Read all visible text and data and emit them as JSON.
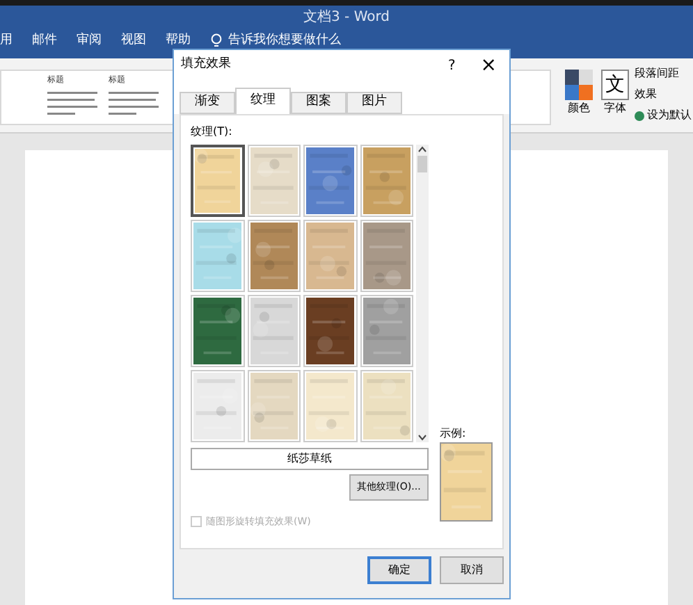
{
  "word": {
    "title": "文档3 - Word",
    "menu": [
      "用",
      "邮件",
      "审阅",
      "视图",
      "帮助"
    ],
    "tell_me": "告诉我你想要做什么",
    "styles": [
      "标题",
      "标题"
    ],
    "colors_label": "颜色",
    "fonts_label": "字体",
    "fonts_glyph": "文",
    "paragraph_spacing": "段落间距",
    "effects": "效果",
    "set_default": "设为默认"
  },
  "dialog": {
    "title": "填充效果",
    "help": "?",
    "close": "×",
    "tabs": [
      {
        "label": "渐变",
        "selected": false
      },
      {
        "label": "纹理",
        "selected": true
      },
      {
        "label": "图案",
        "selected": false
      },
      {
        "label": "图片",
        "selected": false
      }
    ],
    "texture_label": "纹理(T):",
    "textures": [
      {
        "color": "#f0d49a",
        "selected": true
      },
      {
        "color": "#e6dcc8",
        "selected": false
      },
      {
        "color": "#5a80c8",
        "selected": false
      },
      {
        "color": "#c8a060",
        "selected": false
      },
      {
        "color": "#a8dce8",
        "selected": false
      },
      {
        "color": "#b08858",
        "selected": false
      },
      {
        "color": "#d8b890",
        "selected": false
      },
      {
        "color": "#a89888",
        "selected": false
      },
      {
        "color": "#2e6a40",
        "selected": false
      },
      {
        "color": "#d8d8d8",
        "selected": false
      },
      {
        "color": "#6a3e22",
        "selected": false
      },
      {
        "color": "#a0a0a0",
        "selected": false
      },
      {
        "color": "#ececec",
        "selected": false
      },
      {
        "color": "#e4d8c0",
        "selected": false
      },
      {
        "color": "#f4e8cc",
        "selected": false
      },
      {
        "color": "#ece0c0",
        "selected": false
      }
    ],
    "texture_name": "纸莎草纸",
    "more_button": "其他纹理(O)...",
    "sample_label": "示例:",
    "rotate_checkbox": {
      "label": "随图形旋转填充效果(W)",
      "checked": false,
      "disabled": true
    },
    "ok": "确定",
    "cancel": "取消"
  }
}
